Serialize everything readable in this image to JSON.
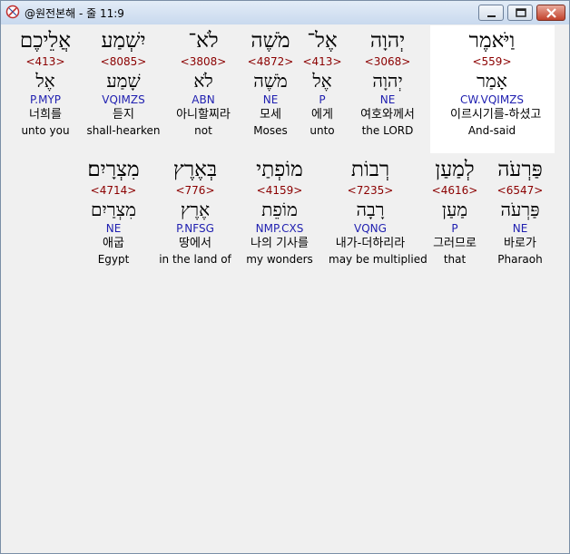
{
  "window": {
    "title": "@원전본해 - 줄 11:9"
  },
  "lines": [
    {
      "words": [
        {
          "hebrew": "וַיֹּאמֶר",
          "strong": "<559>",
          "lemma": "אָמַר",
          "morph": "CW.VQIMZS",
          "korean": "이르시기를-하셨고",
          "english": "And-said"
        },
        {
          "hebrew": "יְהוָה",
          "strong": "<3068>",
          "lemma": "יְהוָה",
          "morph": "NE",
          "korean": "여호와께서",
          "english": "the LORD"
        },
        {
          "hebrew": "אֶל־",
          "strong": "<413>",
          "lemma": "אֶל",
          "morph": "P",
          "korean": "에게",
          "english": "unto"
        },
        {
          "hebrew": "מֹשֶׁה",
          "strong": "<4872>",
          "lemma": "מֹשֶׁה",
          "morph": "NE",
          "korean": "모세",
          "english": "Moses"
        },
        {
          "hebrew": "לֹא־",
          "strong": "<3808>",
          "lemma": "לֹא",
          "morph": "ABN",
          "korean": "아니할찌라",
          "english": "not"
        },
        {
          "hebrew": "יִשְׁמַע",
          "strong": "<8085>",
          "lemma": "שָׁמַע",
          "morph": "VQIMZS",
          "korean": "듣지",
          "english": "shall-hearken"
        },
        {
          "hebrew": "אֲלֵיכֶם",
          "strong": "<413>",
          "lemma": "אֶל",
          "morph": "P.MYP",
          "korean": "너희를",
          "english": "unto you"
        }
      ]
    },
    {
      "words": [
        {
          "hebrew": "פַּרְעֹה",
          "strong": "<6547>",
          "lemma": "פַּרְעֹה",
          "morph": "NE",
          "korean": "바로가",
          "english": "Pharaoh"
        },
        {
          "hebrew": "לְמַעַן",
          "strong": "<4616>",
          "lemma": "מַעַן",
          "morph": "P",
          "korean": "그러므로",
          "english": "that"
        },
        {
          "hebrew": "רְבוֹת",
          "strong": "<7235>",
          "lemma": "רָבָה",
          "morph": "VQNG",
          "korean": "내가-더하리라",
          "english": "may be multiplied"
        },
        {
          "hebrew": "מוֹפְתַי",
          "strong": "<4159>",
          "lemma": "מוֹפֵת",
          "morph": "NMP.CXS",
          "korean": "나의 기사를",
          "english": "my wonders"
        },
        {
          "hebrew": "בְּאֶרֶץ",
          "strong": "<776>",
          "lemma": "אֶרֶץ",
          "morph": "P.NFSG",
          "korean": "땅에서",
          "english": "in the land of"
        },
        {
          "hebrew": "מִצְרָיִם׃",
          "strong": "<4714>",
          "lemma": "מִצְרַיִם",
          "morph": "NE",
          "korean": "애굽",
          "english": "Egypt"
        }
      ]
    }
  ]
}
